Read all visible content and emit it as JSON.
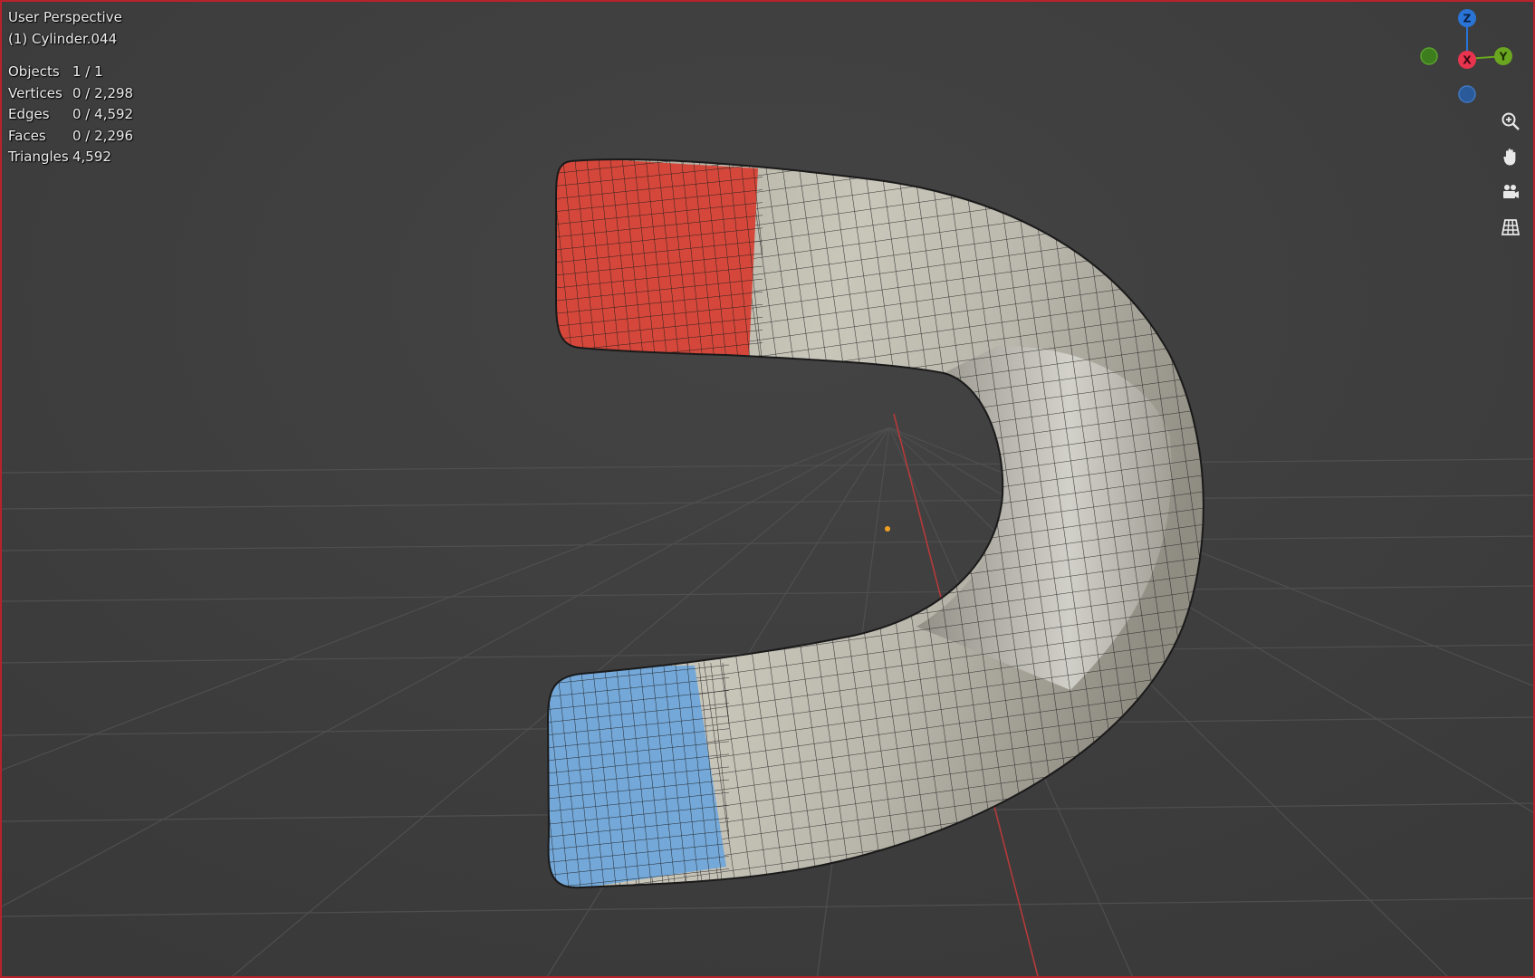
{
  "viewport": {
    "view_name": "User Perspective",
    "object_name": "(1) Cylinder.044"
  },
  "stats": [
    {
      "label": "Objects",
      "value": "1 / 1"
    },
    {
      "label": "Vertices",
      "value": "0 / 2,298"
    },
    {
      "label": "Edges",
      "value": "0 / 4,592"
    },
    {
      "label": "Faces",
      "value": "0 / 2,296"
    },
    {
      "label": "Triangles",
      "value": "4,592"
    }
  ],
  "gizmo": {
    "z_label": "Z",
    "x_label": "X",
    "y_label": "Y",
    "z_color": "#2a74d6",
    "x_color": "#e8344e",
    "y_color": "#6aa61f",
    "neg_y_color": "#3e7d1e",
    "neg_z_color": "#2a5a9a"
  },
  "nav_icons": [
    "zoom-icon",
    "pan-hand-icon",
    "camera-view-icon",
    "ortho-grid-icon"
  ],
  "colors": {
    "background": "#3d3d3d",
    "mesh_gray": "#b6b3a7",
    "red_cap": "#d4473a",
    "blue_cap": "#74a8d8",
    "frame_border": "#b8222b",
    "x_axis_line": "#b63a3a"
  }
}
